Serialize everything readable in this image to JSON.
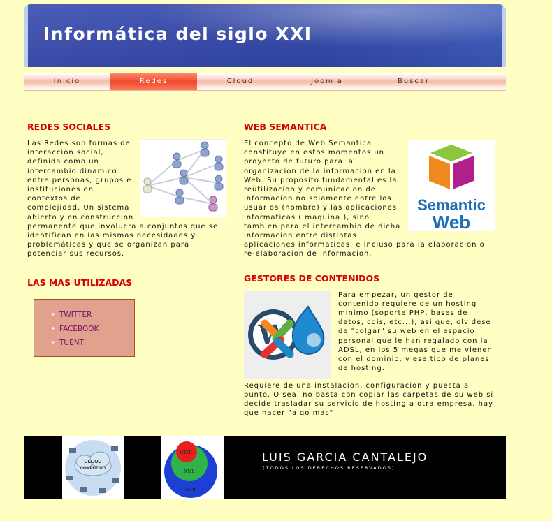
{
  "header": {
    "title": "Informática del siglo XXI"
  },
  "nav": {
    "items": [
      "Inicio",
      "Redes",
      "Cloud",
      "Joomla",
      "Buscar"
    ],
    "active": "Redes"
  },
  "redes": {
    "title": "REDES SOCIALES",
    "text": "Las Redes son formas de interacción social, definida como un intercambio dinamico entre personas, grupos e instituciones en contextos de complejidad. Un sistema abierto y en construccion permanente que involucra a conjuntos que se identifican en las mismas necesidades y problemáticas y que se organizan para potenciar sus recursos."
  },
  "utilizadas": {
    "title": "LAS MAS UTILIZADAS",
    "links": [
      "TWITTER",
      "FACEBOOK",
      "TUENTI"
    ]
  },
  "semantica": {
    "title": "WEB SEMANTICA",
    "text": "El concepto de Web Semantica constituye en estos momentos un proyecto de futuro para la organizacion de la informacion en la Web. Su proposito fundamental es la reutilizacion y comunicacion de informacion no solamente entre los usuarios (hombre) y las aplicaciones informaticas ( maquina ), sino tambien para el intercambio de dicha informacion entre distintas aplicaciones informaticas, e incluso para la elaboracion o re-elaboracion de informacion.",
    "logo_line1": "Semantic",
    "logo_line2": "Web"
  },
  "gestores": {
    "title": "GESTORES DE CONTENIDOS",
    "text1": "Para empezar, un gestor de contenido requiere de un hosting minimo (soporte PHP, bases de datos, cgis, etc...), asi que, olvidese de \"colgar\" su web en el espacio personal que le han regalado con la ADSL, en los 5 megas que me vienen con el dominio, y ese tipo de planes de hosting.",
    "text2": "Requiere de una instalacion, configuracion y puesta a punto. O sea, no basta con copiar las carpetas de su web si decide trasladar su servicio de hosting a otra empresa, hay que hacer \"algo mas\""
  },
  "footer": {
    "name": "LUIS GARCIA CANTALEJO",
    "rights": "(TODOS LOS DERECHOS RESERVADOS)",
    "cloud_label_1": "CLOUD",
    "cloud_label_2": "COMPUTING",
    "ring_labels": [
      "HTML",
      "XML",
      "SGML"
    ]
  },
  "colors": {
    "accent": "#d90000",
    "background": "#ffffc4",
    "header": "#3347a8",
    "nav_active": "#ef4a2e"
  }
}
